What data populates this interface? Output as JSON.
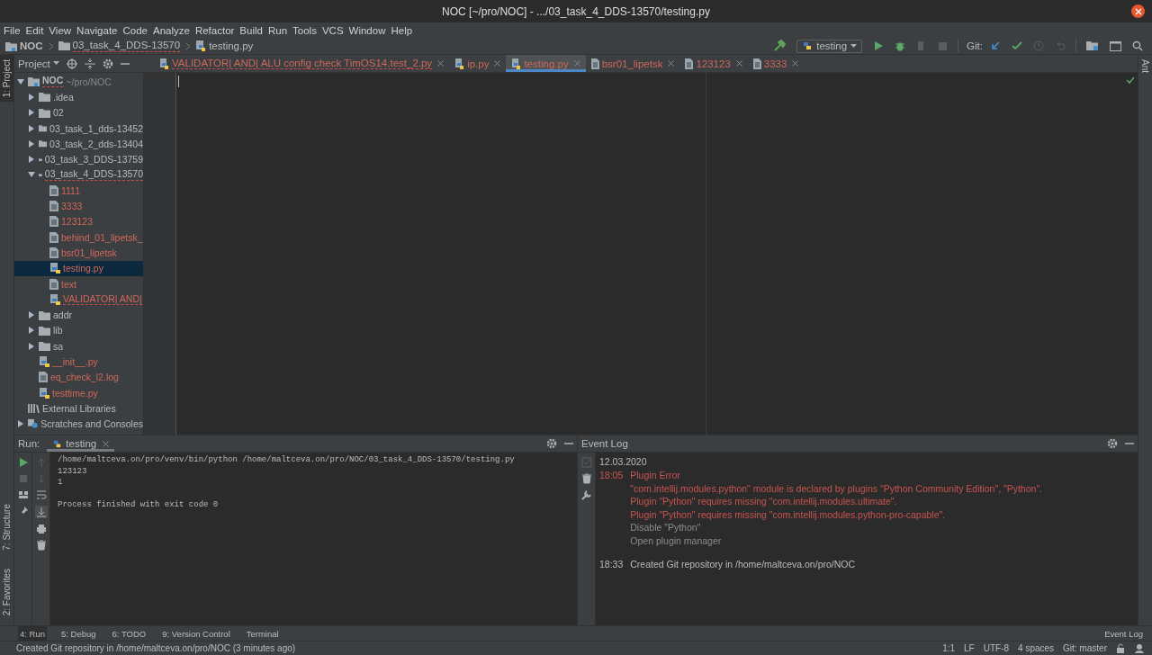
{
  "window": {
    "title": "NOC [~/pro/NOC] - .../03_task_4_DDS-13570/testing.py"
  },
  "menu": [
    "File",
    "Edit",
    "View",
    "Navigate",
    "Code",
    "Analyze",
    "Refactor",
    "Build",
    "Run",
    "Tools",
    "VCS",
    "Window",
    "Help"
  ],
  "breadcrumbs": [
    {
      "label": "NOC",
      "kind": "root"
    },
    {
      "label": "03_task_4_DDS-13570",
      "kind": "folder"
    },
    {
      "label": "testing.py",
      "kind": "py"
    }
  ],
  "toolbar": {
    "run_config": "testing",
    "git_label": "Git:"
  },
  "left_stripe": {
    "top": [
      {
        "label": "1: Project",
        "selected": true
      }
    ],
    "bottom": [
      {
        "label": "7: Structure",
        "selected": false
      },
      {
        "label": "2: Favorites",
        "selected": false
      }
    ]
  },
  "right_stripe": [
    {
      "label": "Ant"
    }
  ],
  "project_panel": {
    "title": "Project"
  },
  "editor_tabs": [
    {
      "label": "VALIDATOR| AND| ALU config check TimOS14.test_2.py",
      "kind": "py",
      "selected": false,
      "error": true
    },
    {
      "label": "ip.py",
      "kind": "py",
      "selected": false,
      "error": false
    },
    {
      "label": "testing.py",
      "kind": "py",
      "selected": true,
      "error": false
    },
    {
      "label": "bsr01_lipetsk",
      "kind": "file",
      "selected": false,
      "error": false
    },
    {
      "label": "123123",
      "kind": "file",
      "selected": false,
      "error": false
    },
    {
      "label": "3333",
      "kind": "file",
      "selected": false,
      "error": false
    }
  ],
  "tree": [
    {
      "label": "NOC",
      "hint": "~/pro/NOC",
      "kind": "root",
      "expanded": true,
      "selected": false,
      "untracked": false,
      "error": true,
      "children": [
        {
          "label": ".idea",
          "kind": "folder",
          "expanded": false,
          "selected": false,
          "untracked": false,
          "error": false
        },
        {
          "label": "02",
          "kind": "folder",
          "expanded": false,
          "selected": false,
          "untracked": false,
          "error": false
        },
        {
          "label": "03_task_1_dds-13452",
          "kind": "folder",
          "expanded": false,
          "selected": false,
          "untracked": false,
          "error": false
        },
        {
          "label": "03_task_2_dds-13404",
          "kind": "folder",
          "expanded": false,
          "selected": false,
          "untracked": false,
          "error": false
        },
        {
          "label": "03_task_3_DDS-13759",
          "kind": "folder",
          "expanded": false,
          "selected": false,
          "untracked": false,
          "error": false
        },
        {
          "label": "03_task_4_DDS-13570",
          "kind": "folder",
          "expanded": true,
          "selected": false,
          "untracked": false,
          "error": true,
          "children": [
            {
              "label": "1111",
              "kind": "file",
              "selected": false,
              "untracked": true,
              "error": false
            },
            {
              "label": "3333",
              "kind": "file",
              "selected": false,
              "untracked": true,
              "error": false
            },
            {
              "label": "123123",
              "kind": "file",
              "selected": false,
              "untracked": true,
              "error": false
            },
            {
              "label": "behind_01_lipetsk_",
              "kind": "file",
              "selected": false,
              "untracked": true,
              "error": false
            },
            {
              "label": "bsr01_lipetsk",
              "kind": "file",
              "selected": false,
              "untracked": true,
              "error": false
            },
            {
              "label": "testing.py",
              "kind": "py",
              "selected": true,
              "untracked": true,
              "error": false
            },
            {
              "label": "text",
              "kind": "file",
              "selected": false,
              "untracked": true,
              "error": false
            },
            {
              "label": "VALIDATOR| AND|",
              "kind": "py",
              "selected": false,
              "untracked": true,
              "error": true
            }
          ]
        },
        {
          "label": "addr",
          "kind": "folder",
          "expanded": false,
          "selected": false,
          "untracked": false,
          "error": false
        },
        {
          "label": "lib",
          "kind": "folder",
          "expanded": false,
          "selected": false,
          "untracked": false,
          "error": false
        },
        {
          "label": "sa",
          "kind": "folder",
          "expanded": false,
          "selected": false,
          "untracked": false,
          "error": false
        },
        {
          "label": "__init__.py",
          "kind": "py",
          "selected": false,
          "untracked": true,
          "error": false
        },
        {
          "label": "eq_check_l2.log",
          "kind": "file",
          "selected": false,
          "untracked": true,
          "error": false
        },
        {
          "label": "testtime.py",
          "kind": "py",
          "selected": false,
          "untracked": true,
          "error": false
        }
      ]
    },
    {
      "label": "External Libraries",
      "kind": "libs",
      "selected": false,
      "untracked": false,
      "error": false
    },
    {
      "label": "Scratches and Consoles",
      "kind": "scratches",
      "expanded": false,
      "selected": false,
      "untracked": false,
      "error": false
    }
  ],
  "run_panel": {
    "title": "Run:",
    "tab": "testing",
    "output": [
      {
        "text": "/home/maltceva.on/pro/venv/bin/python /home/maltceva.on/pro/NOC/03_task_4_DDS-13570/testing.py",
        "gap_before": false
      },
      {
        "text": "123123",
        "gap_before": false
      },
      {
        "text": "1",
        "gap_before": false
      },
      {
        "text": "Process finished with exit code 0",
        "gap_before": true
      }
    ]
  },
  "event_log": {
    "title": "Event Log",
    "date": "12.03.2020",
    "entries": [
      {
        "time": "18:05",
        "error": true,
        "lines": [
          {
            "text": "Plugin Error",
            "kind": "message"
          },
          {
            "text": "\"com.intellij.modules.python\" module is declared by plugins \"Python Community Edition\", \"Python\".",
            "kind": "message"
          },
          {
            "text": "Plugin \"Python\" requires missing \"com.intellij.modules.ultimate\".",
            "kind": "message"
          },
          {
            "text": "Plugin \"Python\" requires missing \"com.intellij.modules.python-pro-capable\".",
            "kind": "message"
          },
          {
            "text": "Disable \"Python\"",
            "kind": "action"
          },
          {
            "text": "Open plugin manager",
            "kind": "action"
          }
        ]
      },
      {
        "time": "18:33",
        "error": false,
        "lines": [
          {
            "text": "Created Git repository in /home/maltceva.on/pro/NOC",
            "kind": "message"
          }
        ]
      }
    ]
  },
  "tool_windows": [
    {
      "label": "4: Run",
      "selected": true
    },
    {
      "label": "5: Debug",
      "selected": false
    },
    {
      "label": "6: TODO",
      "selected": false
    },
    {
      "label": "9: Version Control",
      "selected": false
    },
    {
      "label": "Terminal",
      "selected": false
    }
  ],
  "tool_windows_right": [
    "Event Log"
  ],
  "status_bar": {
    "message": "Created Git repository in /home/maltceva.on/pro/NOC (3 minutes ago)",
    "items": [
      "1:1",
      "LF",
      "UTF-8",
      "4 spaces",
      "Git: master"
    ]
  }
}
